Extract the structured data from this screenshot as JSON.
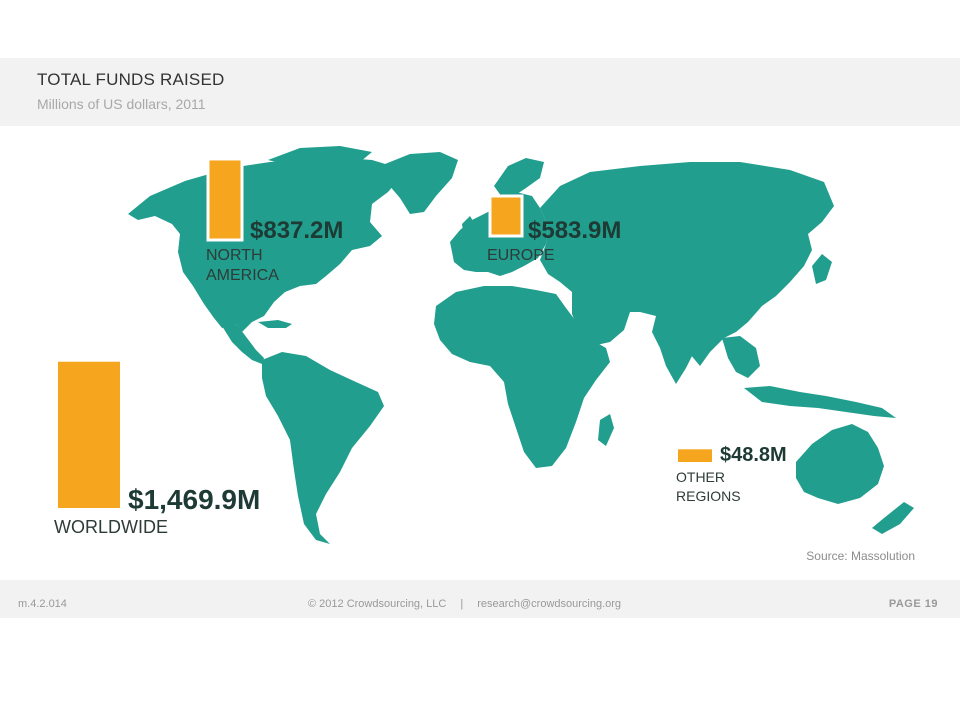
{
  "header": {
    "title": "TOTAL FUNDS RAISED",
    "subtitle": "Millions of US dollars, 2011"
  },
  "colors": {
    "land": "#219e8d",
    "bar": "#f5a51e",
    "header_band": "#f2f2f2"
  },
  "chart_data": {
    "type": "bar",
    "title": "TOTAL FUNDS RAISED",
    "subtitle": "Millions of US dollars, 2011",
    "unit": "Millions of US dollars",
    "categories": [
      "NORTH AMERICA",
      "EUROPE",
      "OTHER REGIONS",
      "WORLDWIDE"
    ],
    "values": [
      837.2,
      583.9,
      48.8,
      1469.9
    ],
    "value_labels": [
      "$837.2M",
      "$583.9M",
      "$48.8M",
      "$1,469.9M"
    ],
    "region_labels": [
      [
        "NORTH",
        "AMERICA"
      ],
      [
        "EUROPE"
      ],
      [
        "OTHER",
        "REGIONS"
      ],
      [
        "WORLDWIDE"
      ]
    ],
    "background": "world map"
  },
  "source": "Source: Massolution",
  "footer": {
    "version": "m.4.2.014",
    "copyright": "© 2012 Crowdsourcing, LLC",
    "separator": "|",
    "email": "research@crowdsourcing.org",
    "page": "PAGE 19"
  }
}
